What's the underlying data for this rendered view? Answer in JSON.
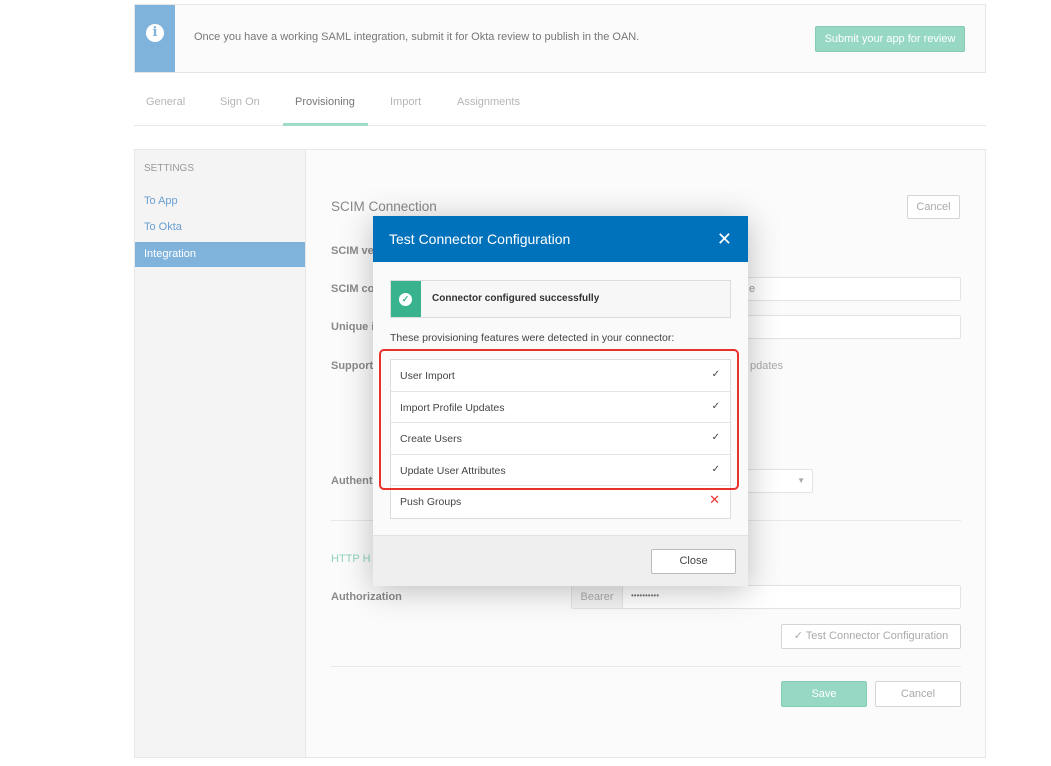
{
  "banner": {
    "icon": "info-icon",
    "message": "Once you have a working SAML integration, submit it for Okta review to publish in the OAN.",
    "submit_label": "Submit your app for review"
  },
  "tabs": [
    {
      "label": "General"
    },
    {
      "label": "Sign On"
    },
    {
      "label": "Provisioning",
      "active": true
    },
    {
      "label": "Import"
    },
    {
      "label": "Assignments"
    }
  ],
  "sidebar": {
    "heading": "SETTINGS",
    "items": [
      {
        "label": "To App"
      },
      {
        "label": "To Okta"
      },
      {
        "label": "Integration",
        "selected": true
      }
    ]
  },
  "main": {
    "title": "SCIM Connection",
    "cancel_top": "Cancel",
    "label_version": "SCIM ve",
    "label_connector": "SCIM co",
    "label_unique": "Unique i",
    "label_supported": "Support",
    "supported_tail": "pdates",
    "field_tail": "e",
    "label_auth": "Authenti",
    "http_header": "HTTP H",
    "authorization_label": "Authorization",
    "bearer": "Bearer",
    "token": "••••••••••",
    "test_button": "Test Connector Configuration",
    "save": "Save",
    "cancel": "Cancel"
  },
  "modal": {
    "title": "Test Connector Configuration",
    "success": "Connector configured successfully",
    "detected": "These provisioning features were detected in your connector:",
    "features": [
      {
        "label": "User Import",
        "status": "✓"
      },
      {
        "label": "Import Profile Updates",
        "status": "✓"
      },
      {
        "label": "Create Users",
        "status": "✓"
      },
      {
        "label": "Update User Attributes",
        "status": "✓"
      },
      {
        "label": "Push Groups",
        "status": "✕"
      }
    ],
    "close": "Close"
  },
  "colors": {
    "modal_header": "#0072bb",
    "success": "#39b38d",
    "accent_green": "#96d8c3",
    "highlight": "#e8312a",
    "sidebar_selected": "#7fb3dc"
  }
}
